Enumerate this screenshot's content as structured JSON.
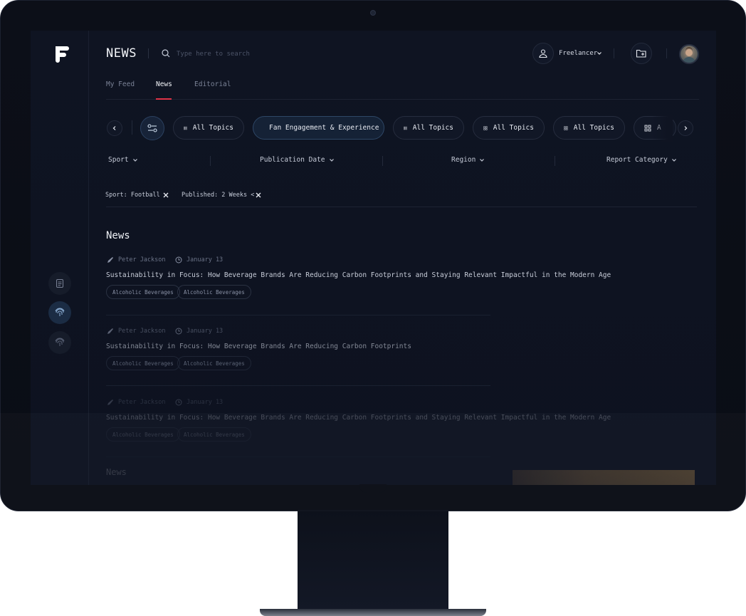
{
  "header": {
    "title": "NEWS",
    "search_placeholder": "Type here to search",
    "role_label": "Freelancer"
  },
  "tabs": [
    {
      "label": "My Feed"
    },
    {
      "label": "News"
    },
    {
      "label": "Editorial"
    }
  ],
  "topics": [
    {
      "label": "All Topics"
    },
    {
      "label": "Fan Engagement & Experience"
    },
    {
      "label": "All Topics"
    },
    {
      "label": "All Topics"
    },
    {
      "label": "All Topics"
    },
    {
      "label": "A"
    }
  ],
  "filters": [
    {
      "label": "Sport"
    },
    {
      "label": "Publication Date"
    },
    {
      "label": "Region"
    },
    {
      "label": "Report Category"
    }
  ],
  "active_filters": [
    {
      "label": "Sport: Football"
    },
    {
      "label": "Published: 2 Weeks <"
    }
  ],
  "news": {
    "section_title": "News",
    "items": [
      {
        "author": "Peter Jackson",
        "date": "January 13",
        "headline": "Sustainability in Focus: How Beverage Brands Are Reducing Carbon Footprints and Staying Relevant Impactful in the Modern Age",
        "tags": [
          "Alcoholic Beverages",
          "Alcoholic Beverages"
        ]
      },
      {
        "author": "Peter Jackson",
        "date": "January 13",
        "headline": "Sustainability in Focus: How Beverage Brands Are Reducing Carbon Footprints",
        "tags": [
          "Alcoholic Beverages",
          "Alcoholic Beverages"
        ]
      },
      {
        "author": "Peter Jackson",
        "date": "January 13",
        "headline": "Sustainability in Focus: How Beverage Brands Are Reducing Carbon Footprints and Staying Relevant Impactful in the Modern Age",
        "tags": [
          "Alcoholic Beverages",
          "Alcoholic Beverages"
        ]
      }
    ],
    "next_section_title": "News"
  },
  "colors": {
    "accent_red": "#e03347",
    "background": "#0f1422",
    "active_chip": "#152236"
  }
}
